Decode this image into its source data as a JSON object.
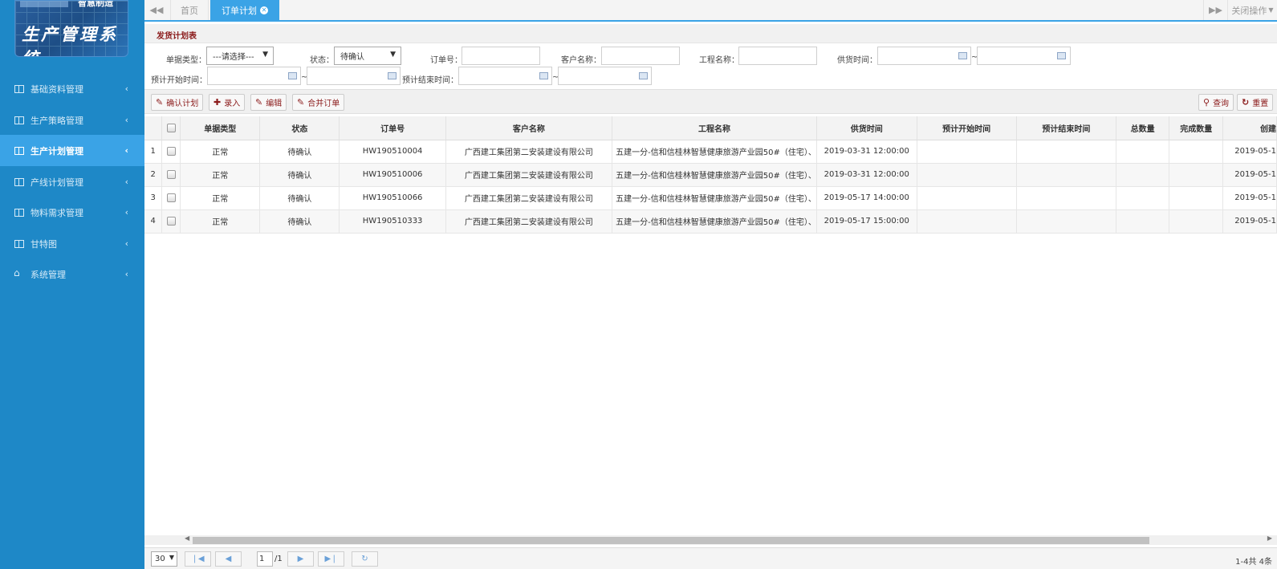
{
  "logo": {
    "top_text": "智慧制造",
    "title": "生产管理系统"
  },
  "sidebar": {
    "items": [
      {
        "label": "基础资料管理",
        "icon": "columns-icon",
        "active": false
      },
      {
        "label": "生产策略管理",
        "icon": "columns-icon",
        "active": false
      },
      {
        "label": "生产计划管理",
        "icon": "columns-icon",
        "active": true
      },
      {
        "label": "产线计划管理",
        "icon": "columns-icon",
        "active": false
      },
      {
        "label": "物料需求管理",
        "icon": "columns-icon",
        "active": false
      },
      {
        "label": "甘特图",
        "icon": "columns-icon",
        "active": false
      },
      {
        "label": "系统管理",
        "icon": "home-icon",
        "active": false
      }
    ]
  },
  "tabs": {
    "home": "首页",
    "active": "订单计划",
    "close_ops": "关闭操作",
    "close_icon": "x-circle-icon"
  },
  "panel": {
    "title": "发货计划表"
  },
  "filters": {
    "doc_type_label": "单据类型：",
    "doc_type_value": "---请选择---",
    "status_label": "状态：",
    "status_value": "待确认",
    "order_no_label": "订单号：",
    "customer_label": "客户名称：",
    "project_label": "工程名称：",
    "supply_time_label": "供货时间：",
    "plan_start_label": "预计开始时间：",
    "plan_end_label": "预计结束时间：",
    "range_sep": "~"
  },
  "toolbar": {
    "confirm_plan": "确认计划",
    "add": "录入",
    "edit": "编辑",
    "merge": "合并订单",
    "query": "查询",
    "reset": "重置"
  },
  "table": {
    "columns": [
      "单据类型",
      "状态",
      "订单号",
      "客户名称",
      "工程名称",
      "供货时间",
      "预计开始时间",
      "预计结束时间",
      "总数量",
      "完成数量",
      "创建"
    ],
    "rows": [
      {
        "num": "1",
        "type": "正常",
        "status": "待确认",
        "order_no": "HW190510004",
        "customer": "广西建工集团第二安装建设有限公司",
        "project": "五建一分-信和信桂林智慧健康旅游产业园50#（住宅）、",
        "supply_time": "2019-03-31 12:00:00",
        "plan_start": "",
        "plan_end": "",
        "total": "",
        "done": "",
        "created": "2019-05-1"
      },
      {
        "num": "2",
        "type": "正常",
        "status": "待确认",
        "order_no": "HW190510006",
        "customer": "广西建工集团第二安装建设有限公司",
        "project": "五建一分-信和信桂林智慧健康旅游产业园50#（住宅）、",
        "supply_time": "2019-03-31 12:00:00",
        "plan_start": "",
        "plan_end": "",
        "total": "",
        "done": "",
        "created": "2019-05-1"
      },
      {
        "num": "3",
        "type": "正常",
        "status": "待确认",
        "order_no": "HW190510066",
        "customer": "广西建工集团第二安装建设有限公司",
        "project": "五建一分-信和信桂林智慧健康旅游产业园50#（住宅）、",
        "supply_time": "2019-05-17 14:00:00",
        "plan_start": "",
        "plan_end": "",
        "total": "",
        "done": "",
        "created": "2019-05-1"
      },
      {
        "num": "4",
        "type": "正常",
        "status": "待确认",
        "order_no": "HW190510333",
        "customer": "广西建工集团第二安装建设有限公司",
        "project": "五建一分-信和信桂林智慧健康旅游产业园50#（住宅）、",
        "supply_time": "2019-05-17 15:00:00",
        "plan_start": "",
        "plan_end": "",
        "total": "",
        "done": "",
        "created": "2019-05-1"
      }
    ]
  },
  "pager": {
    "page_size": "30",
    "current_page": "1",
    "total_pages": "/1",
    "info": "1-4共 4条"
  },
  "colors": {
    "sidebar": "#1e88c7",
    "active": "#3aa3e6",
    "accent_text": "#8b1b1b"
  }
}
